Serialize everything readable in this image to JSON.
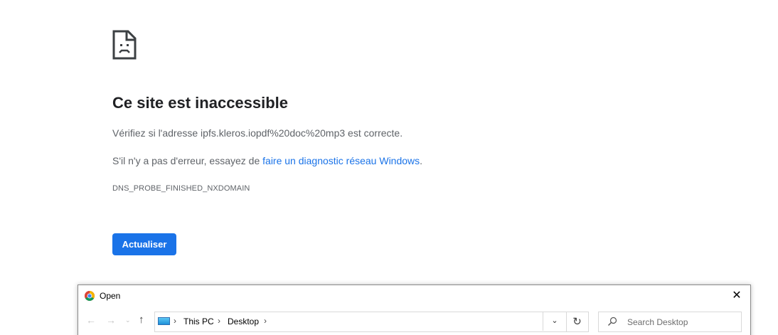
{
  "error_page": {
    "title": "Ce site est inaccessible",
    "check_address_text": "Vérifiez si l'adresse ipfs.kleros.iopdf%20doc%20mp3 est correcte.",
    "no_error_prefix": "S'il n'y a pas d'erreur, essayez de ",
    "diagnostic_link": "faire un diagnostic réseau Windows",
    "no_error_suffix": ".",
    "error_code": "DNS_PROBE_FINISHED_NXDOMAIN",
    "reload_button": "Actualiser",
    "accent_color": "#1a73e8",
    "icon": "sad-document-icon"
  },
  "open_dialog": {
    "title": "Open",
    "app_icon": "chrome-icon",
    "close_glyph": "✕",
    "nav": {
      "back": "←",
      "forward": "→",
      "recent": "⌄",
      "up": "↑"
    },
    "breadcrumb": [
      "This PC",
      "Desktop"
    ],
    "breadcrumb_separator": "›",
    "dropdown_glyph": "⌄",
    "refresh_glyph": "↻",
    "search_placeholder": "Search Desktop"
  }
}
